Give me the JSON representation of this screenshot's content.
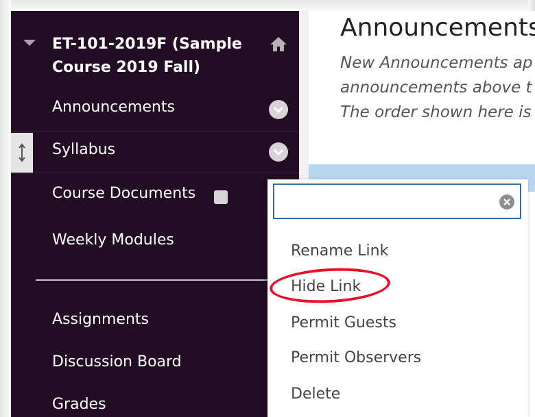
{
  "course": {
    "title": "ET-101-2019F (Sample Course 2019 Fall)"
  },
  "nav": {
    "items": [
      {
        "label": "Announcements"
      },
      {
        "label": "Syllabus"
      },
      {
        "label": "Course Documents"
      },
      {
        "label": "Weekly Modules"
      },
      {
        "label": "Assignments"
      },
      {
        "label": "Discussion Board"
      },
      {
        "label": "Grades"
      }
    ]
  },
  "main": {
    "title": "Announcements",
    "description_lines": [
      "New Announcements ap",
      "announcements above t",
      "The order shown here is"
    ]
  },
  "menu": {
    "search_value": "",
    "items": [
      {
        "label": "Rename Link"
      },
      {
        "label": "Hide Link"
      },
      {
        "label": "Permit Guests"
      },
      {
        "label": "Permit Observers"
      },
      {
        "label": "Delete"
      }
    ]
  },
  "colors": {
    "sidebar_bg": "#220d24",
    "highlight": "#e8112a",
    "focus_border": "#2d6db4"
  }
}
